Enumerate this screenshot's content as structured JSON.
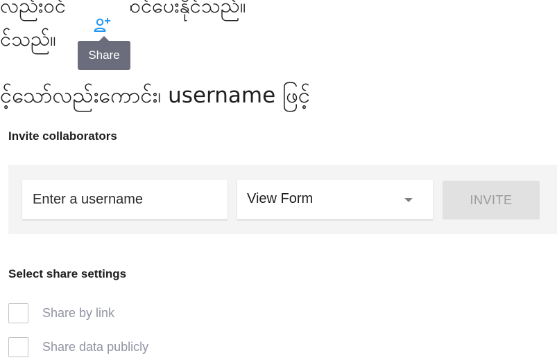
{
  "background": {
    "line_1": "လည်းဝင်      ကြပြင်ဆင်ပေးနိုင်သည်။",
    "line_2": "င်သည်။",
    "line_3": "င့်သော်လည်းကောင်း၊ username ဖြင့်"
  },
  "tooltip": {
    "icon": "person-add-icon",
    "label": "Share"
  },
  "invite": {
    "heading": "Invite collaborators",
    "username_placeholder": "Enter a username",
    "username_value": "",
    "permission_selected": "View Form",
    "invite_label": "INVITE"
  },
  "share_settings": {
    "heading": "Select share settings",
    "options": [
      {
        "label": "Share by link",
        "checked": false
      },
      {
        "label": "Share data publicly",
        "checked": false
      }
    ]
  },
  "colors": {
    "icon_blue": "#2196f3",
    "tooltip_bg": "#6b6d7c",
    "panel_bg": "#f4f4f4",
    "button_disabled_bg": "#e1e1e1",
    "option_text": "#9194a3"
  }
}
